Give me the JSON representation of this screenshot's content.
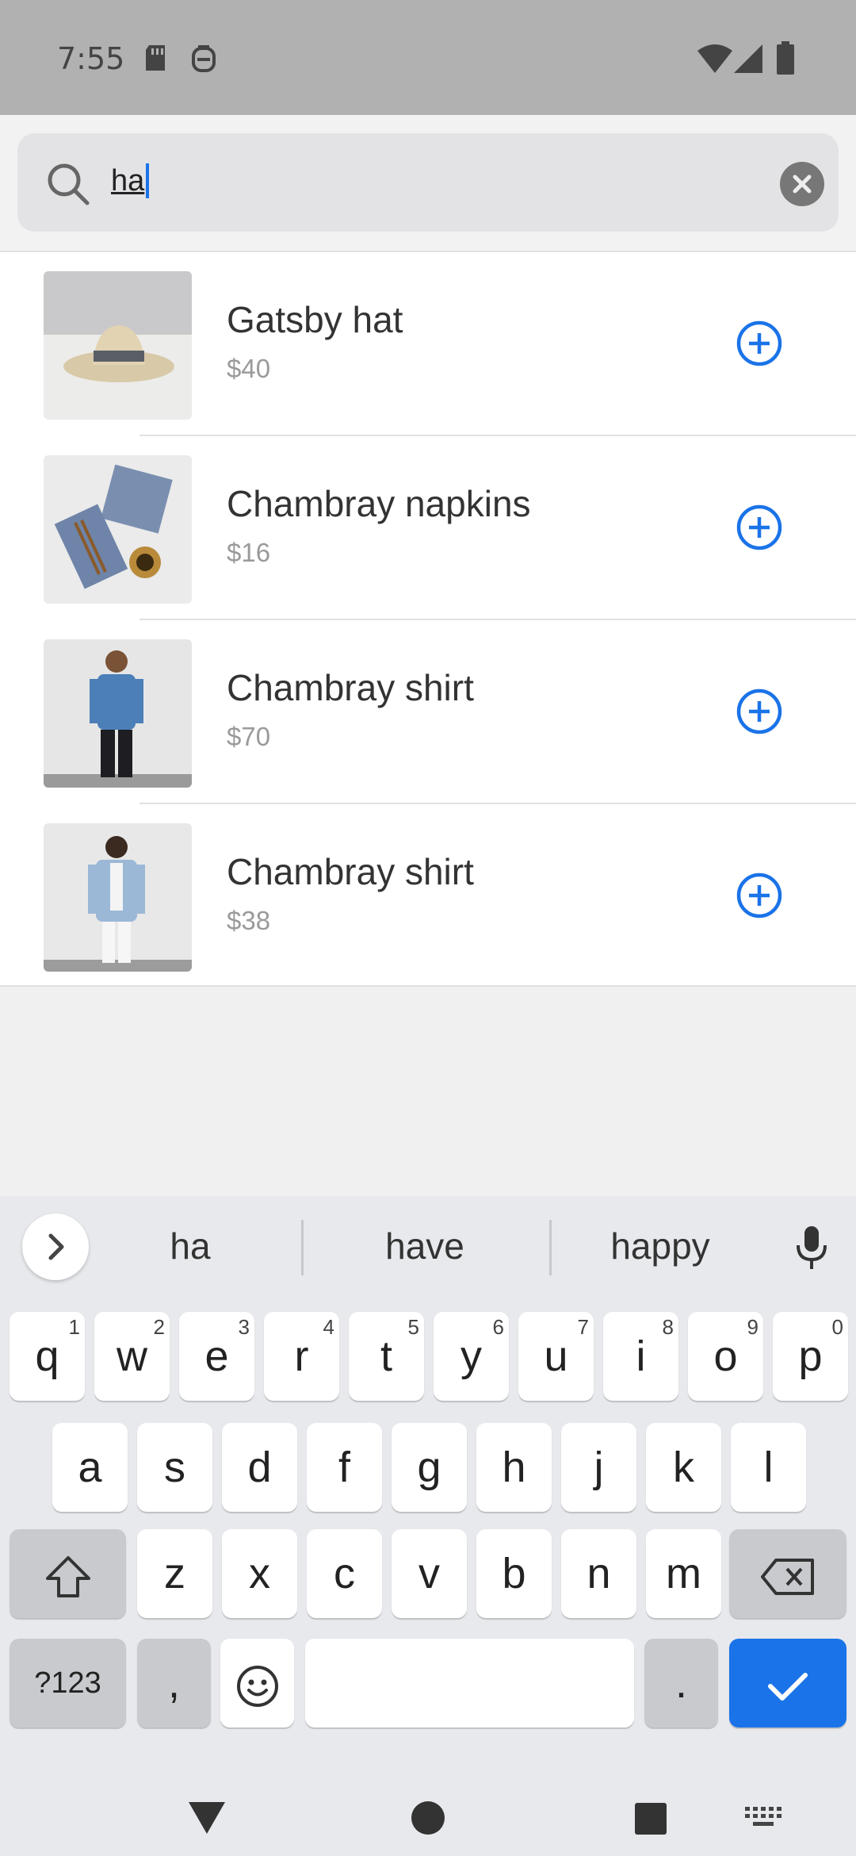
{
  "status_bar": {
    "time": "7:55",
    "icons": [
      "sd-card-icon",
      "hand-icon",
      "wifi-icon",
      "signal-icon",
      "battery-icon"
    ]
  },
  "search": {
    "query": "ha",
    "icon": "search-icon",
    "clear_icon": "clear-icon"
  },
  "results": [
    {
      "name": "Gatsby hat",
      "price": "$40",
      "image": "hat-thumbnail"
    },
    {
      "name": "Chambray napkins",
      "price": "$16",
      "image": "napkins-thumbnail"
    },
    {
      "name": "Chambray shirt",
      "price": "$70",
      "image": "mens-shirt-thumbnail"
    },
    {
      "name": "Chambray shirt",
      "price": "$38",
      "image": "womens-shirt-thumbnail"
    }
  ],
  "keyboard": {
    "suggestions": [
      "ha",
      "have",
      "happy"
    ],
    "row1": [
      [
        "q",
        "1"
      ],
      [
        "w",
        "2"
      ],
      [
        "e",
        "3"
      ],
      [
        "r",
        "4"
      ],
      [
        "t",
        "5"
      ],
      [
        "y",
        "6"
      ],
      [
        "u",
        "7"
      ],
      [
        "i",
        "8"
      ],
      [
        "o",
        "9"
      ],
      [
        "p",
        "0"
      ]
    ],
    "row2": [
      "a",
      "s",
      "d",
      "f",
      "g",
      "h",
      "j",
      "k",
      "l"
    ],
    "row3": [
      "z",
      "x",
      "c",
      "v",
      "b",
      "n",
      "m"
    ],
    "symbols_key": "?123",
    "comma_key": ",",
    "period_key": "."
  },
  "colors": {
    "accent": "#1a73e8",
    "status_bar": "#b1b1b2",
    "keyboard_bg": "#e8e9ed"
  }
}
